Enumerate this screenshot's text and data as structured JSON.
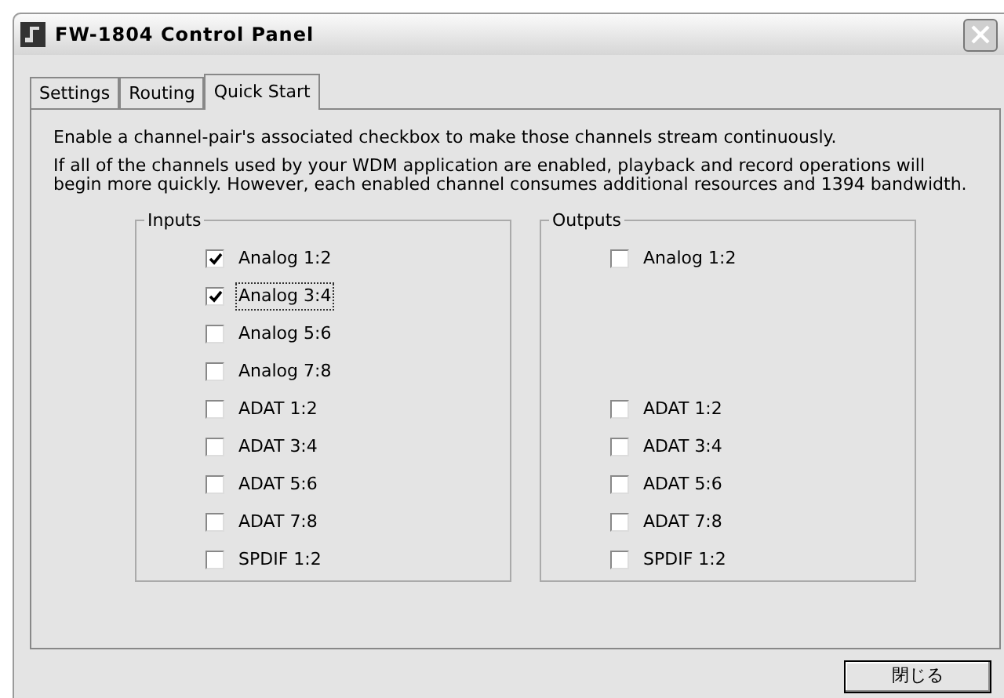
{
  "window": {
    "title": "FW-1804 Control Panel"
  },
  "tabs": [
    {
      "label": "Settings",
      "selected": false
    },
    {
      "label": "Routing",
      "selected": false
    },
    {
      "label": "Quick Start",
      "selected": true
    }
  ],
  "intro": "Enable a channel-pair's associated checkbox to make those channels stream continuously.",
  "note": "If all of the channels used by your WDM application are enabled, playback and record operations will begin more quickly. However, each enabled channel consumes additional resources and 1394 bandwidth.",
  "groups": [
    {
      "title": "Inputs",
      "items": [
        {
          "kind": "checkbox",
          "label": "Analog 1:2",
          "checked": true,
          "focused": false
        },
        {
          "kind": "checkbox",
          "label": "Analog 3:4",
          "checked": true,
          "focused": true
        },
        {
          "kind": "checkbox",
          "label": "Analog 5:6",
          "checked": false,
          "focused": false
        },
        {
          "kind": "checkbox",
          "label": "Analog 7:8",
          "checked": false,
          "focused": false
        },
        {
          "kind": "checkbox",
          "label": "ADAT 1:2",
          "checked": false,
          "focused": false
        },
        {
          "kind": "checkbox",
          "label": "ADAT 3:4",
          "checked": false,
          "focused": false
        },
        {
          "kind": "checkbox",
          "label": "ADAT 5:6",
          "checked": false,
          "focused": false
        },
        {
          "kind": "checkbox",
          "label": "ADAT 7:8",
          "checked": false,
          "focused": false
        },
        {
          "kind": "checkbox",
          "label": "SPDIF 1:2",
          "checked": false,
          "focused": false
        }
      ]
    },
    {
      "title": "Outputs",
      "items": [
        {
          "kind": "checkbox",
          "label": "Analog 1:2",
          "checked": false,
          "focused": false
        },
        {
          "kind": "gap"
        },
        {
          "kind": "gap"
        },
        {
          "kind": "gap"
        },
        {
          "kind": "checkbox",
          "label": "ADAT 1:2",
          "checked": false,
          "focused": false
        },
        {
          "kind": "checkbox",
          "label": "ADAT 3:4",
          "checked": false,
          "focused": false
        },
        {
          "kind": "checkbox",
          "label": "ADAT 5:6",
          "checked": false,
          "focused": false
        },
        {
          "kind": "checkbox",
          "label": "ADAT 7:8",
          "checked": false,
          "focused": false
        },
        {
          "kind": "checkbox",
          "label": "SPDIF 1:2",
          "checked": false,
          "focused": false
        }
      ]
    }
  ],
  "buttons": [
    {
      "label": "閉じる"
    }
  ]
}
